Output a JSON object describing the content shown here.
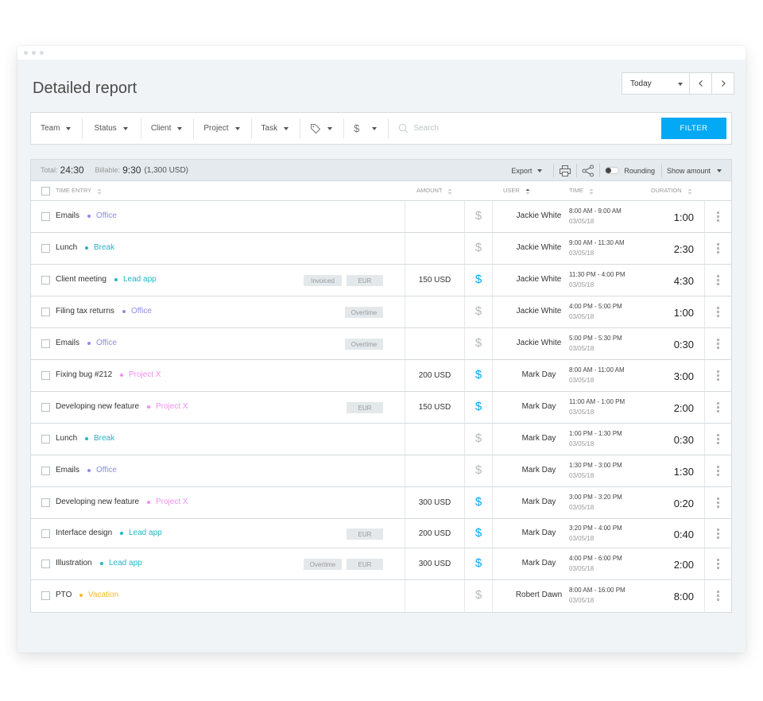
{
  "page": {
    "title": "Detailed report"
  },
  "date": {
    "selected": "Today",
    "prev_icon": "chevron-left-icon",
    "next_icon": "chevron-right-icon"
  },
  "filters": {
    "items": [
      "Team",
      "Status",
      "Client",
      "Project",
      "Task"
    ],
    "tag_icon": "tag-icon",
    "billable_icon": "dollar-icon",
    "search_placeholder": "Search",
    "filter_button": "FILTER"
  },
  "summary": {
    "total_label": "Total:",
    "total_value": "24:30",
    "billable_label": "Billable:",
    "billable_value": "9:30",
    "billable_amount": "(1,300 USD)",
    "export_label": "Export",
    "rounding_label": "Rounding",
    "show_amount_label": "Show amount"
  },
  "columns": {
    "time_entry": "TIME ENTRY",
    "amount": "AMOUNT",
    "user": "USER",
    "time": "TIME",
    "duration": "DURATION"
  },
  "colors": {
    "accent": "#03a9f4",
    "office": "#8c8ee0",
    "break": "#23b5c9",
    "lead_app": "#23b5c9",
    "project_x": "#f28ff0",
    "vacation": "#f5b92a"
  },
  "rows": [
    {
      "desc": "Emails",
      "project": "Office",
      "color": "#8c8ee0",
      "tags": [],
      "amount": "",
      "billable": false,
      "user": "Jackie White",
      "time": "8:00 AM - 9:00 AM",
      "date": "03/05/18",
      "duration": "1:00"
    },
    {
      "desc": "Lunch",
      "project": "Break",
      "color": "#23b5c9",
      "tags": [],
      "amount": "",
      "billable": false,
      "user": "Jackie White",
      "time": "9:00 AM - 11:30 AM",
      "date": "03/05/18",
      "duration": "2:30"
    },
    {
      "desc": "Client meeting",
      "project": "Lead app",
      "color": "#23b5c9",
      "tags": [
        "Invoiced",
        "EUR"
      ],
      "amount": "150 USD",
      "billable": true,
      "user": "Jackie White",
      "time": "11:30 PM - 4:00 PM",
      "date": "03/05/18",
      "duration": "4:30"
    },
    {
      "desc": "Filing tax returns",
      "project": "Office",
      "color": "#8c8ee0",
      "tags": [
        "Overtime"
      ],
      "amount": "",
      "billable": false,
      "user": "Jackie White",
      "time": "4:00 PM - 5:00 PM",
      "date": "03/05/18",
      "duration": "1:00"
    },
    {
      "desc": "Emails",
      "project": "Office",
      "color": "#8c8ee0",
      "tags": [
        "Overtime"
      ],
      "amount": "",
      "billable": false,
      "user": "Jackie White",
      "time": "5:00 PM - 5:30 PM",
      "date": "03/05/18",
      "duration": "0:30"
    },
    {
      "desc": "Fixing bug #212",
      "project": "Project X",
      "color": "#f28ff0",
      "tags": [],
      "amount": "200 USD",
      "billable": true,
      "user": "Mark Day",
      "time": "8:00 AM - 11:00 AM",
      "date": "03/05/18",
      "duration": "3:00"
    },
    {
      "desc": "Developing new feature",
      "project": "Project X",
      "color": "#f28ff0",
      "tags": [
        "EUR"
      ],
      "amount": "150 USD",
      "billable": true,
      "user": "Mark Day",
      "time": "11:00 AM - 1:00 PM",
      "date": "03/05/18",
      "duration": "2:00"
    },
    {
      "desc": "Lunch",
      "project": "Break",
      "color": "#23b5c9",
      "tags": [],
      "amount": "",
      "billable": false,
      "user": "Mark Day",
      "time": "1:00 PM - 1:30 PM",
      "date": "03/05/18",
      "duration": "0:30"
    },
    {
      "desc": "Emails",
      "project": "Office",
      "color": "#8c8ee0",
      "tags": [],
      "amount": "",
      "billable": false,
      "user": "Mark Day",
      "time": "1:30 PM - 3:00 PM",
      "date": "03/05/18",
      "duration": "1:30"
    },
    {
      "desc": "Developing new feature",
      "project": "Project X",
      "color": "#f28ff0",
      "tags": [],
      "amount": "300 USD",
      "billable": true,
      "user": "Mark Day",
      "time": "3:00 PM - 3:20 PM",
      "date": "03/05/18",
      "duration": "0:20"
    },
    {
      "desc": "Interface design",
      "project": "Lead app",
      "color": "#23b5c9",
      "tags": [
        "EUR"
      ],
      "amount": "200 USD",
      "billable": true,
      "user": "Mark Day",
      "time": "3:20 PM - 4:00 PM",
      "date": "03/05/18",
      "duration": "0:40"
    },
    {
      "desc": "Illustration",
      "project": "Lead app",
      "color": "#23b5c9",
      "tags": [
        "Overtime",
        "EUR"
      ],
      "amount": "300 USD",
      "billable": true,
      "user": "Mark Day",
      "time": "4:00 PM - 6:00 PM",
      "date": "03/05/18",
      "duration": "2:00"
    },
    {
      "desc": "PTO",
      "project": "Vacation",
      "color": "#f5b92a",
      "tags": [],
      "amount": "",
      "billable": false,
      "user": "Robert Dawn",
      "time": "8:00 AM - 16:00 PM",
      "date": "03/05/18",
      "duration": "8:00"
    }
  ]
}
